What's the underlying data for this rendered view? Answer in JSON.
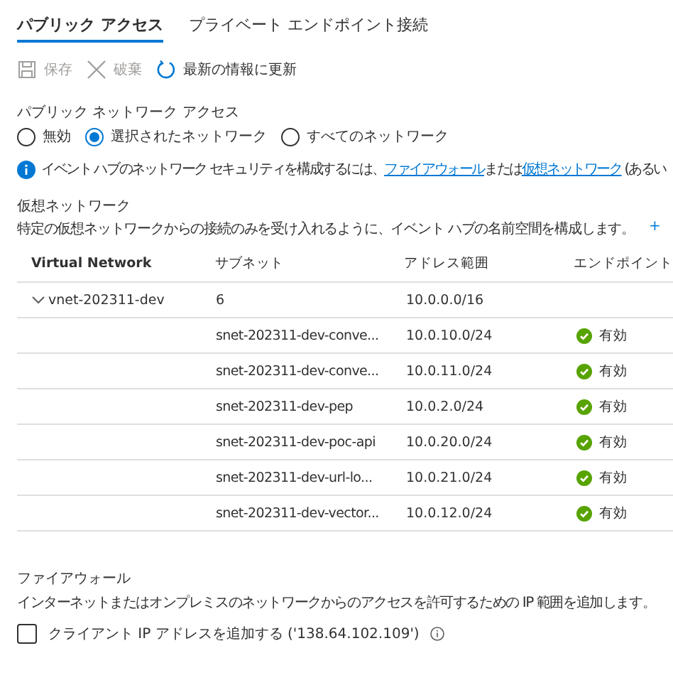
{
  "tabs": [
    {
      "label": "パブリック アクセス",
      "selected": true
    },
    {
      "label": "プライベート エンドポイント接続",
      "selected": false
    }
  ],
  "toolbar": [
    {
      "kind": "save",
      "label": "保存",
      "disabled": true
    },
    {
      "kind": "discard",
      "label": "破棄",
      "disabled": true
    },
    {
      "kind": "refresh",
      "label": "最新の情報に更新",
      "disabled": false
    }
  ],
  "public_network_access": {
    "label": "パブリック ネットワーク アクセス",
    "options": [
      {
        "label": "無効",
        "selected": false
      },
      {
        "label": "選択されたネットワーク",
        "selected": true
      },
      {
        "label": "すべてのネットワーク",
        "selected": false
      }
    ]
  },
  "info": {
    "segments": [
      {
        "kind": "text",
        "text": "イベント ハブのネットワーク セキュリティを構成するには、"
      },
      {
        "kind": "link",
        "text": "ファイアウォール"
      },
      {
        "kind": "text",
        "text": "または"
      },
      {
        "kind": "link",
        "text": "仮想ネットワーク"
      },
      {
        "kind": "text",
        "text": " (あるい"
      }
    ]
  },
  "virtual_networks": {
    "title": "仮想ネットワーク",
    "description": "特定の仮想ネットワークからの接続のみを受け入れるように、イベント ハブの名前空間を構成します。",
    "add_link": "+",
    "columns": [
      "Virtual Network",
      "サブネット",
      "アドレス範囲",
      "エンドポイント"
    ],
    "rows": [
      {
        "name": "vnet-202311-dev",
        "expanded": true,
        "subnet": "6",
        "address": "10.0.0.0/16",
        "children": [
          {
            "subnet": "snet-202311-dev-conve...",
            "address": "10.0.10.0/24",
            "status_label": "有効"
          },
          {
            "subnet": "snet-202311-dev-conve...",
            "address": "10.0.11.0/24",
            "status_label": "有効"
          },
          {
            "subnet": "snet-202311-dev-pep",
            "address": "10.0.2.0/24",
            "status_label": "有効"
          },
          {
            "subnet": "snet-202311-dev-poc-api",
            "address": "10.0.20.0/24",
            "status_label": "有効"
          },
          {
            "subnet": "snet-202311-dev-url-lo...",
            "address": "10.0.21.0/24",
            "status_label": "有効"
          },
          {
            "subnet": "snet-202311-dev-vector...",
            "address": "10.0.12.0/24",
            "status_label": "有効"
          }
        ]
      }
    ]
  },
  "firewall": {
    "title": "ファイアウォール",
    "description": "インターネットまたはオンプレミスのネットワークからのアクセスを許可するための IP 範囲を追加します。",
    "checkbox": {
      "label": "クライアント IP アドレスを追加する ('138.64.102.109')",
      "checked": false
    }
  }
}
